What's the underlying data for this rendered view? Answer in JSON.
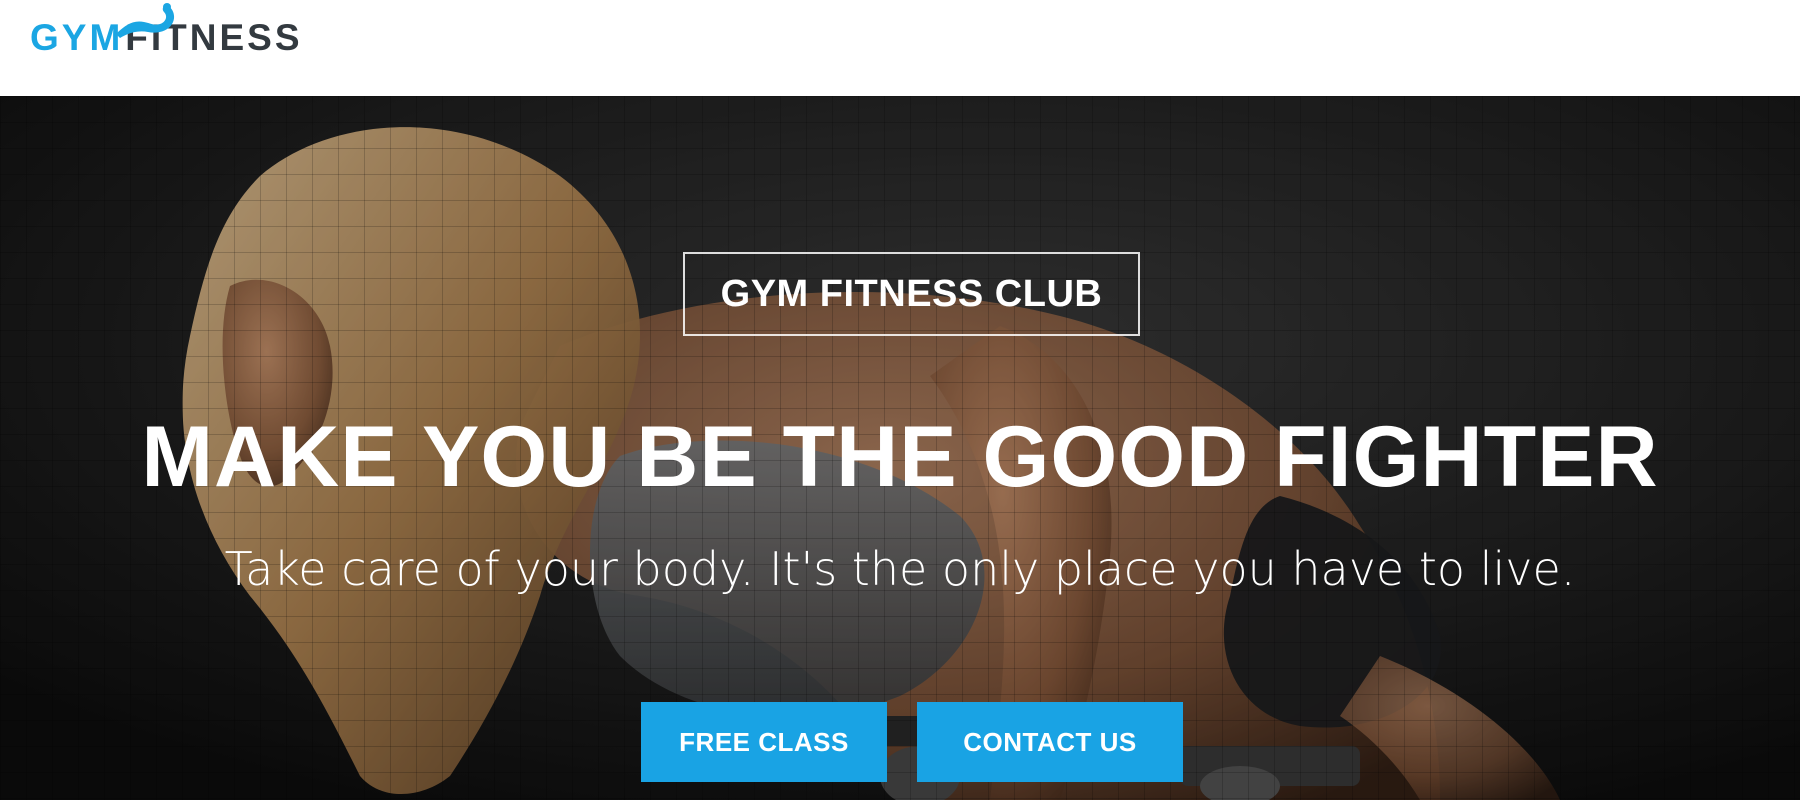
{
  "header": {
    "logo": {
      "part1": "GYM",
      "part2": "FITNESS",
      "icon": "flexed-arm-icon",
      "color_primary": "#1ba6e3",
      "color_secondary": "#333a40"
    }
  },
  "hero": {
    "badge": "GYM FITNESS CLUB",
    "headline": "MAKE YOU BE THE GOOD FIGHTER",
    "tagline": "Take care of your body. It's the only place you have to live.",
    "buttons": [
      {
        "label": "FREE CLASS"
      },
      {
        "label": "CONTACT US"
      }
    ],
    "accent_color": "#19a3e4",
    "background_image": "woman-dumbbell-workout-photo"
  }
}
